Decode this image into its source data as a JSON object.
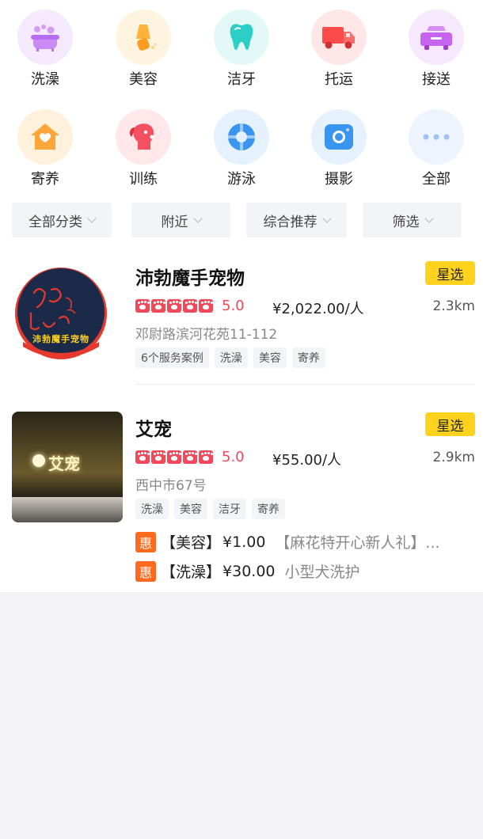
{
  "categories": [
    {
      "label": "洗澡",
      "icon": "bathtub-icon",
      "color": "#b86ef0",
      "bg": "#f5eafd"
    },
    {
      "label": "美容",
      "icon": "comb-icon",
      "color": "#ffab2e",
      "bg": "#fff4df"
    },
    {
      "label": "洁牙",
      "icon": "tooth-icon",
      "color": "#2ccfc6",
      "bg": "#e3f9f8"
    },
    {
      "label": "托运",
      "icon": "truck-icon",
      "color": "#fc4b49",
      "bg": "#ffe7e7"
    },
    {
      "label": "接送",
      "icon": "car-icon",
      "color": "#c664ef",
      "bg": "#f6e8fd"
    },
    {
      "label": "寄养",
      "icon": "house-icon",
      "color": "#ffa63a",
      "bg": "#fff1dc"
    },
    {
      "label": "训练",
      "icon": "dog-icon",
      "color": "#f55060",
      "bg": "#ffe7ea"
    },
    {
      "label": "游泳",
      "icon": "swim-ring-icon",
      "color": "#3a95f0",
      "bg": "#e5f1fd"
    },
    {
      "label": "摄影",
      "icon": "camera-icon",
      "color": "#3a95f0",
      "bg": "#e5f1fd"
    },
    {
      "label": "全部",
      "icon": "more-dots-icon",
      "color": "#9ec3f2",
      "bg": "#edf4fd"
    }
  ],
  "filters": [
    {
      "label": "全部分类"
    },
    {
      "label": "附近"
    },
    {
      "label": "综合推荐"
    },
    {
      "label": "筛选"
    }
  ],
  "shops": [
    {
      "name": "沛勃魔手宠物",
      "badge": "星选",
      "rating": "5.0",
      "price": "¥2,022.00/人",
      "distance": "2.3km",
      "address": "邓尉路滨河花苑11-112",
      "tags": [
        "6个服务案例",
        "洗澡",
        "美容",
        "寄养"
      ],
      "logo_text": "沛勃魔手宠物",
      "deals": []
    },
    {
      "name": "艾宠",
      "badge": "星选",
      "rating": "5.0",
      "price": "¥55.00/人",
      "distance": "2.9km",
      "address": "西中市67号",
      "tags": [
        "洗澡",
        "美容",
        "洁牙",
        "寄养"
      ],
      "logo_text": "艾宠",
      "deals": [
        {
          "mark": "惠",
          "title": "【美容】",
          "price": "¥1.00",
          "desc": "【麻花特开心新人礼】..."
        },
        {
          "mark": "惠",
          "title": "【洗澡】",
          "price": "¥30.00",
          "desc": "小型犬洗护"
        }
      ]
    }
  ],
  "colors": {
    "star": "#f04a5a",
    "badge": "#ffd21e",
    "deal": "#ff6a1f"
  }
}
